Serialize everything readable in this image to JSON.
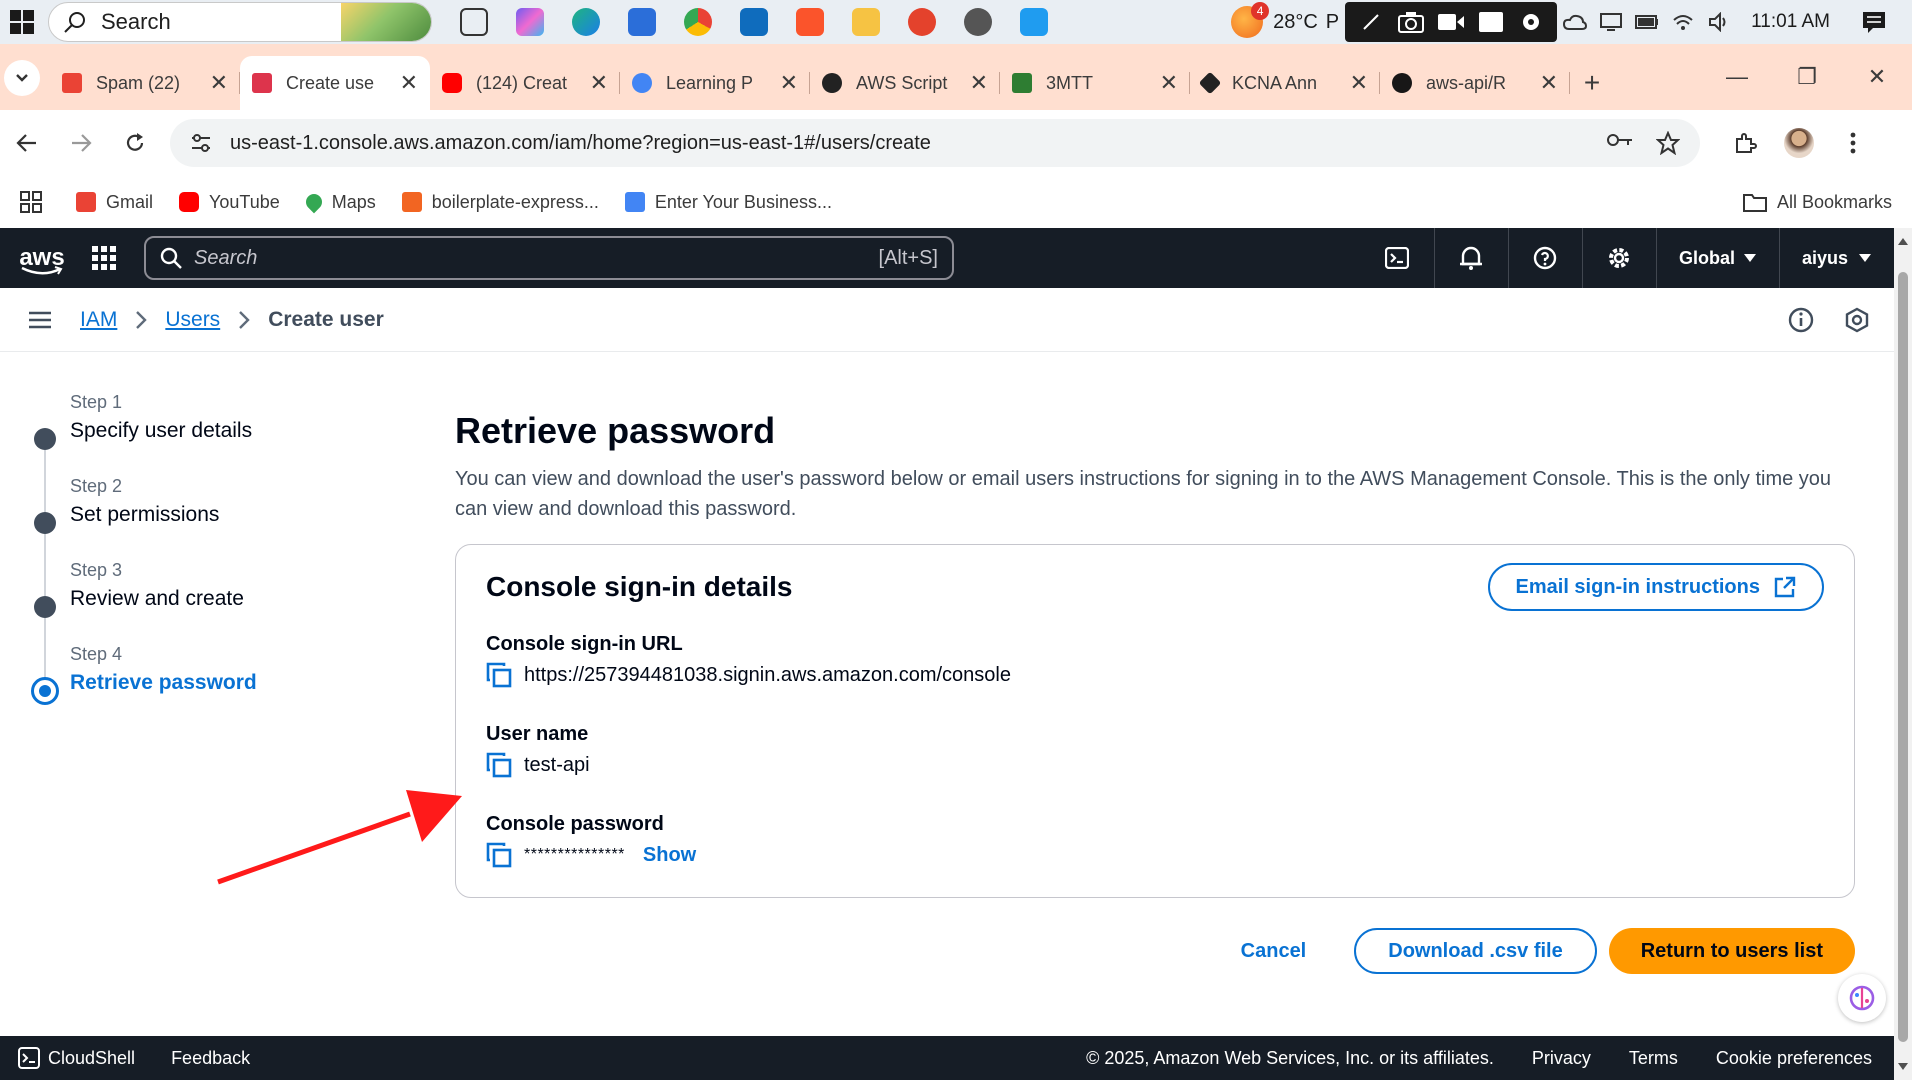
{
  "taskbar": {
    "search_label": "Search",
    "temperature": "28°C",
    "temp_suffix": "P",
    "weather_badge": "4",
    "time": "11:01 AM"
  },
  "tabs": [
    {
      "title": "Spam (22)",
      "color": "#ea4335"
    },
    {
      "title": "Create use",
      "color": "#dd344c",
      "active": true
    },
    {
      "title": "(124) Creat",
      "color": "#ff0000"
    },
    {
      "title": "Learning P",
      "color": "#4285f4"
    },
    {
      "title": "AWS Script",
      "color": "#222222"
    },
    {
      "title": "3MTT",
      "color": "#2e7d32"
    },
    {
      "title": "KCNA Ann",
      "color": "#222222"
    },
    {
      "title": "aws-api/R",
      "color": "#181717"
    }
  ],
  "address": {
    "url": "us-east-1.console.aws.amazon.com/iam/home?region=us-east-1#/users/create"
  },
  "bookmarks": [
    {
      "label": "Gmail",
      "color": "#ea4335"
    },
    {
      "label": "YouTube",
      "color": "#ff0000"
    },
    {
      "label": "Maps",
      "color": "#34a853"
    },
    {
      "label": "boilerplate-express...",
      "color": "#f26522"
    },
    {
      "label": "Enter Your Business...",
      "color": "#4285f4"
    }
  ],
  "bookmarks_all": "All Bookmarks",
  "aws_header": {
    "logo": "aws",
    "search_placeholder": "Search",
    "search_shortcut": "[Alt+S]",
    "region": "Global",
    "account": "aiyus"
  },
  "breadcrumb": {
    "iam": "IAM",
    "users": "Users",
    "current": "Create user"
  },
  "steps": [
    {
      "num": "Step 1",
      "name": "Specify user details"
    },
    {
      "num": "Step 2",
      "name": "Set permissions"
    },
    {
      "num": "Step 3",
      "name": "Review and create"
    },
    {
      "num": "Step 4",
      "name": "Retrieve password",
      "active": true
    }
  ],
  "page": {
    "title": "Retrieve password",
    "description": "You can view and download the user's password below or email users instructions for signing in to the AWS Management Console. This is the only time you can view and download this password."
  },
  "card": {
    "title": "Console sign-in details",
    "email_button": "Email sign-in instructions",
    "url_label": "Console sign-in URL",
    "url_value": "https://257394481038.signin.aws.amazon.com/console",
    "username_label": "User name",
    "username_value": "test-api",
    "password_label": "Console password",
    "password_value": "***************",
    "show_label": "Show"
  },
  "actions": {
    "cancel": "Cancel",
    "download": "Download .csv file",
    "return": "Return to users list"
  },
  "footer": {
    "cloudshell": "CloudShell",
    "feedback": "Feedback",
    "copyright": "© 2025, Amazon Web Services, Inc. or its affiliates.",
    "privacy": "Privacy",
    "terms": "Terms",
    "cookies": "Cookie preferences"
  },
  "colors": {
    "aws_dark": "#161d26",
    "link_blue": "#0972d3",
    "primary_orange": "#ff9900",
    "arrow_red": "#ff1a1a",
    "tab_strip": "#ffdfd0"
  }
}
